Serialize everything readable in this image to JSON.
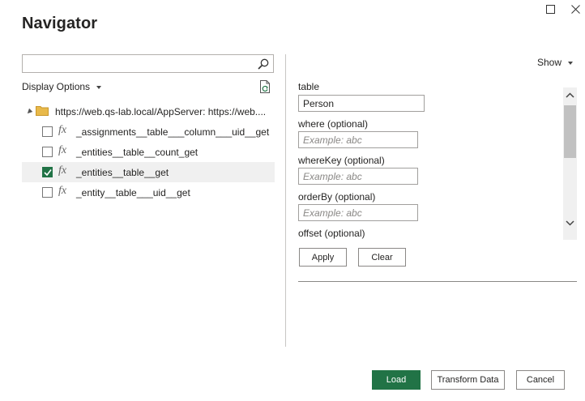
{
  "window": {
    "title": "Navigator"
  },
  "search": {
    "value": "",
    "placeholder": ""
  },
  "left_panel": {
    "display_options_label": "Display Options"
  },
  "tree": {
    "root_label": "https://web.qs-lab.local/AppServer: https://web....",
    "items": [
      {
        "label": "_assignments__table___column___uid__get",
        "checked": false
      },
      {
        "label": "_entities__table__count_get",
        "checked": false
      },
      {
        "label": "_entities__table__get",
        "checked": true
      },
      {
        "label": "_entity__table___uid__get",
        "checked": false
      }
    ]
  },
  "right_panel": {
    "show_label": "Show"
  },
  "params": {
    "table": {
      "label": "table",
      "value": "Person"
    },
    "where": {
      "label": "where (optional)",
      "placeholder": "Example: abc"
    },
    "whereKey": {
      "label": "whereKey (optional)",
      "placeholder": "Example: abc"
    },
    "orderBy": {
      "label": "orderBy (optional)",
      "placeholder": "Example: abc"
    },
    "offset": {
      "label": "offset (optional)"
    },
    "apply_label": "Apply",
    "clear_label": "Clear"
  },
  "footer": {
    "load_label": "Load",
    "transform_label": "Transform Data",
    "cancel_label": "Cancel"
  },
  "colors": {
    "accent": "#217346",
    "selected_row": "#f0f0f0"
  }
}
